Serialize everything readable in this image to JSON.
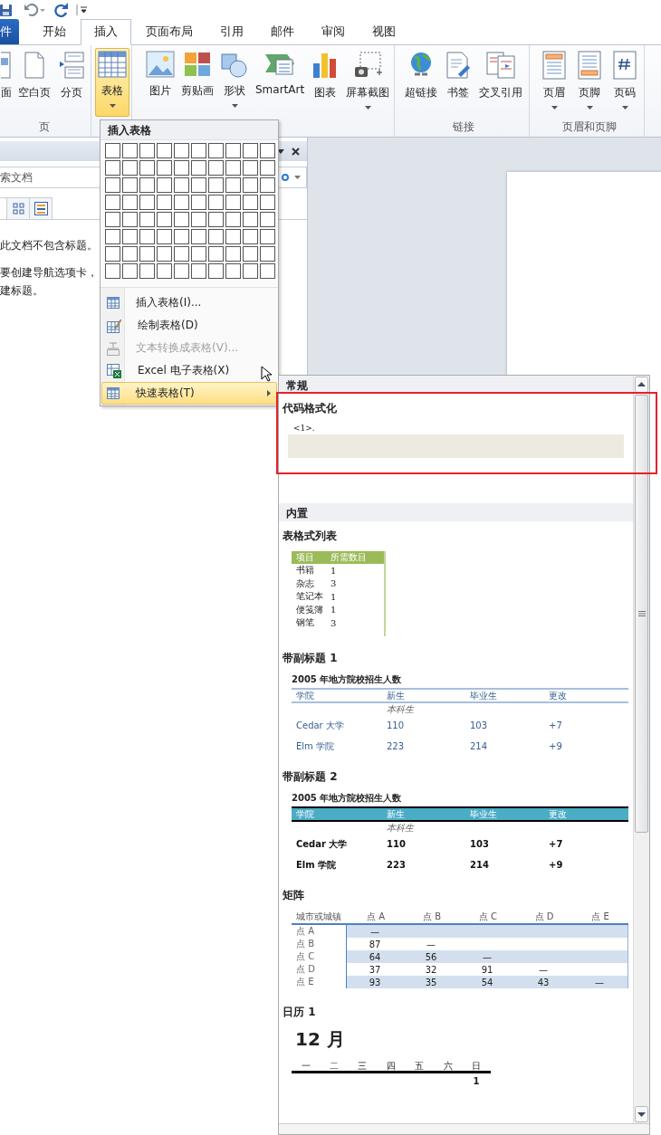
{
  "tabs": [
    {
      "label": "件",
      "kind": "file",
      "selected": false
    },
    {
      "label": "开始",
      "kind": "tab",
      "selected": false
    },
    {
      "label": "插入",
      "kind": "tab",
      "selected": true
    },
    {
      "label": "页面布局",
      "kind": "tab",
      "selected": false
    },
    {
      "label": "引用",
      "kind": "tab",
      "selected": false
    },
    {
      "label": "邮件",
      "kind": "tab",
      "selected": false
    },
    {
      "label": "审阅",
      "kind": "tab",
      "selected": false
    },
    {
      "label": "视图",
      "kind": "tab",
      "selected": false
    }
  ],
  "ribbon": {
    "groups": [
      {
        "label": "页",
        "buttons": [
          {
            "label": "面",
            "dropdown": false,
            "pressed": false
          },
          {
            "label": "空白页",
            "dropdown": false,
            "pressed": false
          },
          {
            "label": "分页",
            "dropdown": false,
            "pressed": false
          }
        ]
      },
      {
        "buttons": [
          {
            "label": "表格",
            "dropdown": true,
            "pressed": true
          }
        ]
      },
      {
        "buttons": [
          {
            "label": "图片",
            "dropdown": false,
            "pressed": false
          },
          {
            "label": "剪贴画",
            "dropdown": false,
            "pressed": false
          },
          {
            "label": "形状",
            "dropdown": true,
            "pressed": false
          },
          {
            "label": "SmartArt",
            "dropdown": false,
            "pressed": false
          },
          {
            "label": "图表",
            "dropdown": false,
            "pressed": false
          },
          {
            "label": "屏幕截图",
            "dropdown": true,
            "pressed": false
          }
        ]
      },
      {
        "label": "链接",
        "buttons": [
          {
            "label": "超链接",
            "dropdown": false,
            "pressed": false
          },
          {
            "label": "书签",
            "dropdown": false,
            "pressed": false
          },
          {
            "label": "交叉引用",
            "dropdown": false,
            "pressed": false
          }
        ]
      },
      {
        "label": "页眉和页脚",
        "buttons": [
          {
            "label": "页眉",
            "dropdown": true,
            "pressed": false
          },
          {
            "label": "页脚",
            "dropdown": true,
            "pressed": false
          },
          {
            "label": "页码",
            "dropdown": true,
            "pressed": false
          }
        ]
      }
    ]
  },
  "navigation_pane": {
    "search": {
      "value": "索文档"
    },
    "messages": [
      "此文档不包含标题。",
      "要创建导航选项卡，",
      "建标题。"
    ]
  },
  "table_menu": {
    "title": "插入表格",
    "items": [
      {
        "label": "插入表格(I)...",
        "disabled": false,
        "selected": false,
        "submenu": false
      },
      {
        "label": "绘制表格(D)",
        "disabled": false,
        "selected": false,
        "submenu": false
      },
      {
        "label": "文本转换成表格(V)...",
        "disabled": true,
        "selected": false,
        "submenu": false
      },
      {
        "label": "Excel 电子表格(X)",
        "disabled": false,
        "selected": false,
        "submenu": false
      },
      {
        "label": "快速表格(T)",
        "disabled": false,
        "selected": true,
        "submenu": true
      }
    ]
  },
  "quick_tables_gallery": {
    "sections": [
      {
        "title": "常规",
        "entries": [
          {
            "kind": "code",
            "title": "代码格式化",
            "highlighted": true,
            "code": "<1>."
          }
        ]
      },
      {
        "title": "内置",
        "entries": [
          {
            "kind": "list",
            "title": "表格式列表",
            "columns": [
              "项目",
              "所需数目"
            ],
            "rows": [
              [
                "书籍",
                "1"
              ],
              [
                "杂志",
                "3"
              ],
              [
                "笔记本",
                "1"
              ],
              [
                "便笺簿",
                "1"
              ],
              [
                "钢笔",
                "3"
              ]
            ]
          },
          {
            "kind": "lined",
            "title": "带副标题 1",
            "caption": "2005 年地方院校招生人数",
            "columns": [
              "学院",
              "新生",
              "毕业生",
              "更改"
            ],
            "group_label": "本科生",
            "rows": [
              [
                "Cedar 大学",
                "110",
                "103",
                "+7"
              ],
              [
                "Elm 学院",
                "223",
                "214",
                "+9"
              ]
            ]
          },
          {
            "kind": "banded",
            "title": "带副标题 2",
            "caption": "2005 年地方院校招生人数",
            "columns": [
              "学院",
              "新生",
              "毕业生",
              "更改"
            ],
            "group_label": "本科生",
            "rows": [
              [
                "Cedar 大学",
                "110",
                "103",
                "+7"
              ],
              [
                "Elm 学院",
                "223",
                "214",
                "+9"
              ]
            ]
          },
          {
            "kind": "matrix",
            "title": "矩阵",
            "columns": [
              "城市或城镇",
              "点 A",
              "点 B",
              "点 C",
              "点 D",
              "点 E"
            ],
            "rows": [
              {
                "label": "点 A",
                "values": [
                  "—"
                ]
              },
              {
                "label": "点 B",
                "values": [
                  "87",
                  "—"
                ]
              },
              {
                "label": "点 C",
                "values": [
                  "64",
                  "56",
                  "—"
                ]
              },
              {
                "label": "点 D",
                "values": [
                  "37",
                  "32",
                  "91",
                  "—"
                ]
              },
              {
                "label": "点 E",
                "values": [
                  "93",
                  "35",
                  "54",
                  "43",
                  "—"
                ]
              }
            ]
          },
          {
            "kind": "calendar",
            "title": "日历 1",
            "month": "12 月",
            "weekdays": [
              "一",
              "二",
              "三",
              "四",
              "五",
              "六",
              "日"
            ],
            "weeks": [
              [
                "1"
              ]
            ]
          }
        ]
      }
    ]
  }
}
